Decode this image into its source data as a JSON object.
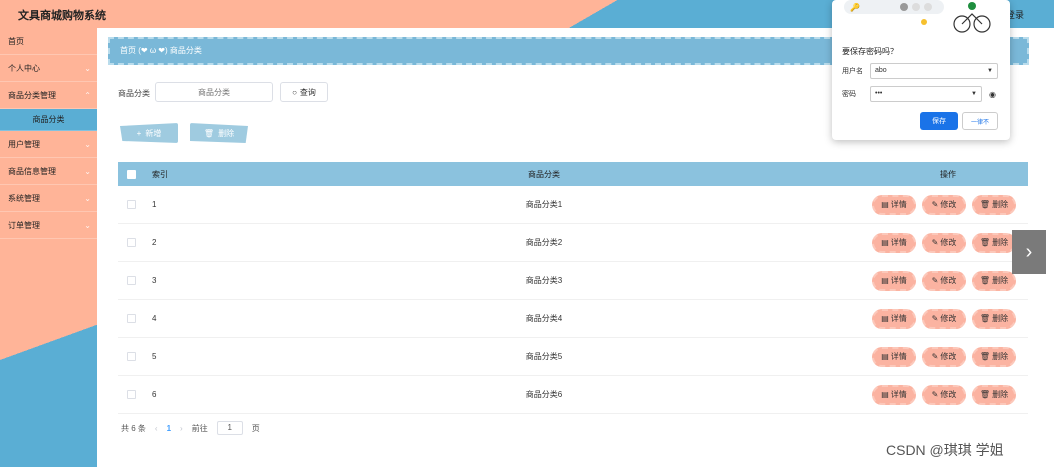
{
  "app": {
    "title": "文具商城购物系统",
    "login": "登录"
  },
  "sidebar": {
    "items": [
      {
        "label": "首页"
      },
      {
        "label": "个人中心"
      },
      {
        "label": "商品分类管理"
      },
      {
        "label": "商品分类"
      },
      {
        "label": "用户管理"
      },
      {
        "label": "商品信息管理"
      },
      {
        "label": "系统管理"
      },
      {
        "label": "订单管理"
      }
    ]
  },
  "breadcrumb": {
    "home": "首页",
    "separator": "(❤ ω ❤)",
    "current": "商品分类"
  },
  "search": {
    "label": "商品分类",
    "placeholder": "商品分类",
    "button": "查询"
  },
  "actions": {
    "add": "新增",
    "delete": "删除"
  },
  "table": {
    "headers": {
      "index": "索引",
      "name": "商品分类",
      "ops": "操作"
    },
    "op_labels": {
      "detail": "详情",
      "edit": "修改",
      "remove": "删除"
    },
    "rows": [
      {
        "index": "1",
        "name": "商品分类1"
      },
      {
        "index": "2",
        "name": "商品分类2"
      },
      {
        "index": "3",
        "name": "商品分类3"
      },
      {
        "index": "4",
        "name": "商品分类4"
      },
      {
        "index": "5",
        "name": "商品分类5"
      },
      {
        "index": "6",
        "name": "商品分类6"
      }
    ]
  },
  "pagination": {
    "total": "共 6 条",
    "current_page": "1",
    "goto_label": "前往",
    "goto_value": "1",
    "page_suffix": "页"
  },
  "password_popup": {
    "question": "要保存密码吗？",
    "username_label": "用户名",
    "username_value": "abo",
    "password_label": "密码",
    "password_value": "•••",
    "save": "保存",
    "never": "一律不"
  },
  "watermark": "CSDN @琪琪 学姐",
  "colors": {
    "salmon": "#ffb498",
    "blue": "#5aaed4",
    "header_blue": "#8bc2de",
    "op_button": "#fbb3a1"
  }
}
